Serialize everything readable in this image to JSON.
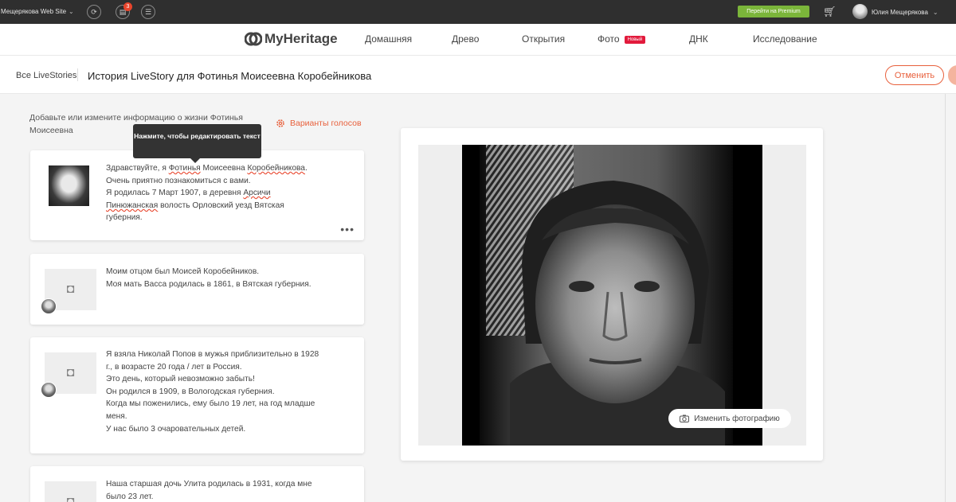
{
  "topbar": {
    "site_name": "Мещерякова Web Site",
    "notifications_count": "3",
    "premium_label": "Перейти на Premium",
    "user_name": "Юлия Мещерякова"
  },
  "header": {
    "logo_text": "MyHeritage",
    "nav": [
      "Домашняя",
      "Древо",
      "Открытия",
      "Фото",
      "ДНК",
      "Исследование"
    ],
    "new_badge": "Новый"
  },
  "subheader": {
    "breadcrumb": "Все LiveStories",
    "title": "История LiveStory для Фотинья Моисеевна Коробейникова",
    "cancel_label": "Отменить"
  },
  "left": {
    "intro": "Добавьте или измените информацию о жизни Фотинья Моисеевна",
    "voices_label": "Варианты голосов",
    "tooltip": "Нажмите, чтобы редактировать текст",
    "card1": {
      "p1": "Здравствуйте, я ",
      "name_first": "Фотинья",
      "p2": " Моисеевна ",
      "name_last": "Коробейникова",
      "p3": ".",
      "l2": "Очень приятно познакомиться с вами.",
      "l3a": "Я родилась 7 Март 1907, в деревня ",
      "place1": "Арсичи",
      "place2": "Пинюжанская",
      "l4b": " волость Орловский уезд Вятская",
      "l5": "губерния.",
      "menu": "•••"
    },
    "card2": {
      "l1": "Моим отцом был Моисей Коробейников.",
      "l2": "Моя мать Васса родилась в 1861, в Вятская губерния."
    },
    "card3": {
      "l1": "Я взяла Николай Попов в мужья приблизительно в 1928",
      "l2": "г., в возрасте 20 года / лет в Россия.",
      "l3": "Это день, который невозможно забыть!",
      "l4": "Он родился в 1909, в Вологодская губерния.",
      "l5": "Когда мы поженились, ему было 19 лет, на год младше",
      "l6": "меня.",
      "l7": "У нас было 3 очаровательных детей."
    },
    "card4": {
      "l1": "Наша старшая дочь Улита родилась в 1931, когда мне",
      "l2": "было 23 лет."
    }
  },
  "photo": {
    "change_label": "Изменить фотографию"
  }
}
